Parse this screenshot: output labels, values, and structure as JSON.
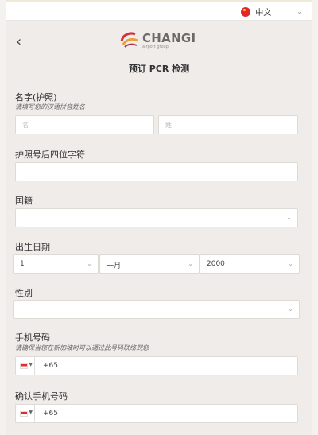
{
  "header": {
    "language": "中文"
  },
  "page": {
    "title": "预订 PCR 检测",
    "brand": "CHANGI",
    "brand_sub": "airport group"
  },
  "form": {
    "name_label": "名字(护照)",
    "name_hint": "请填写您的汉语拼音姓名",
    "first_name_placeholder": "名",
    "last_name_placeholder": "姓",
    "passport_label": "护照号后四位字符",
    "nationality_label": "国籍",
    "dob_label": "出生日期",
    "dob_day": "1",
    "dob_month": "一月",
    "dob_year": "2000",
    "gender_label": "性别",
    "phone_label": "手机号码",
    "phone_hint": "请确保当您在新加坡时可以通过此号码联络到您",
    "phone_code": "+65",
    "confirm_phone_label": "确认手机号码",
    "confirm_phone_code": "+65"
  },
  "colors": {
    "panel_bg": "#efecea",
    "brand_gray": "#6f6963",
    "logo_red": "#d6303a",
    "logo_gold": "#e7a23a"
  }
}
